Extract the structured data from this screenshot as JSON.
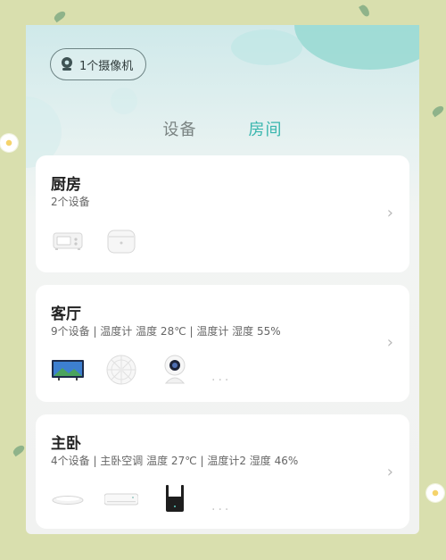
{
  "camera_pill": {
    "label": "1个摄像机",
    "icon": "camera-icon"
  },
  "tabs": [
    {
      "label": "设备",
      "active": false
    },
    {
      "label": "房间",
      "active": true
    }
  ],
  "rooms": [
    {
      "name": "厨房",
      "summary": "2个设备",
      "devices": [
        "microwave-icon",
        "rice-cooker-icon"
      ],
      "more": ""
    },
    {
      "name": "客厅",
      "summary": "9个设备 | 温度计 温度 28℃ | 温度计 湿度 55%",
      "devices": [
        "tv-icon",
        "fan-icon",
        "camera-icon"
      ],
      "more": "..."
    },
    {
      "name": "主卧",
      "summary": "4个设备 | 主卧空调 温度 27℃ | 温度计2 湿度 46%",
      "devices": [
        "ceiling-light-icon",
        "air-conditioner-icon",
        "wifi-extender-icon"
      ],
      "more": "..."
    }
  ],
  "colors": {
    "accent": "#39b6ae",
    "background": "#d9dfae",
    "card": "#ffffff"
  }
}
